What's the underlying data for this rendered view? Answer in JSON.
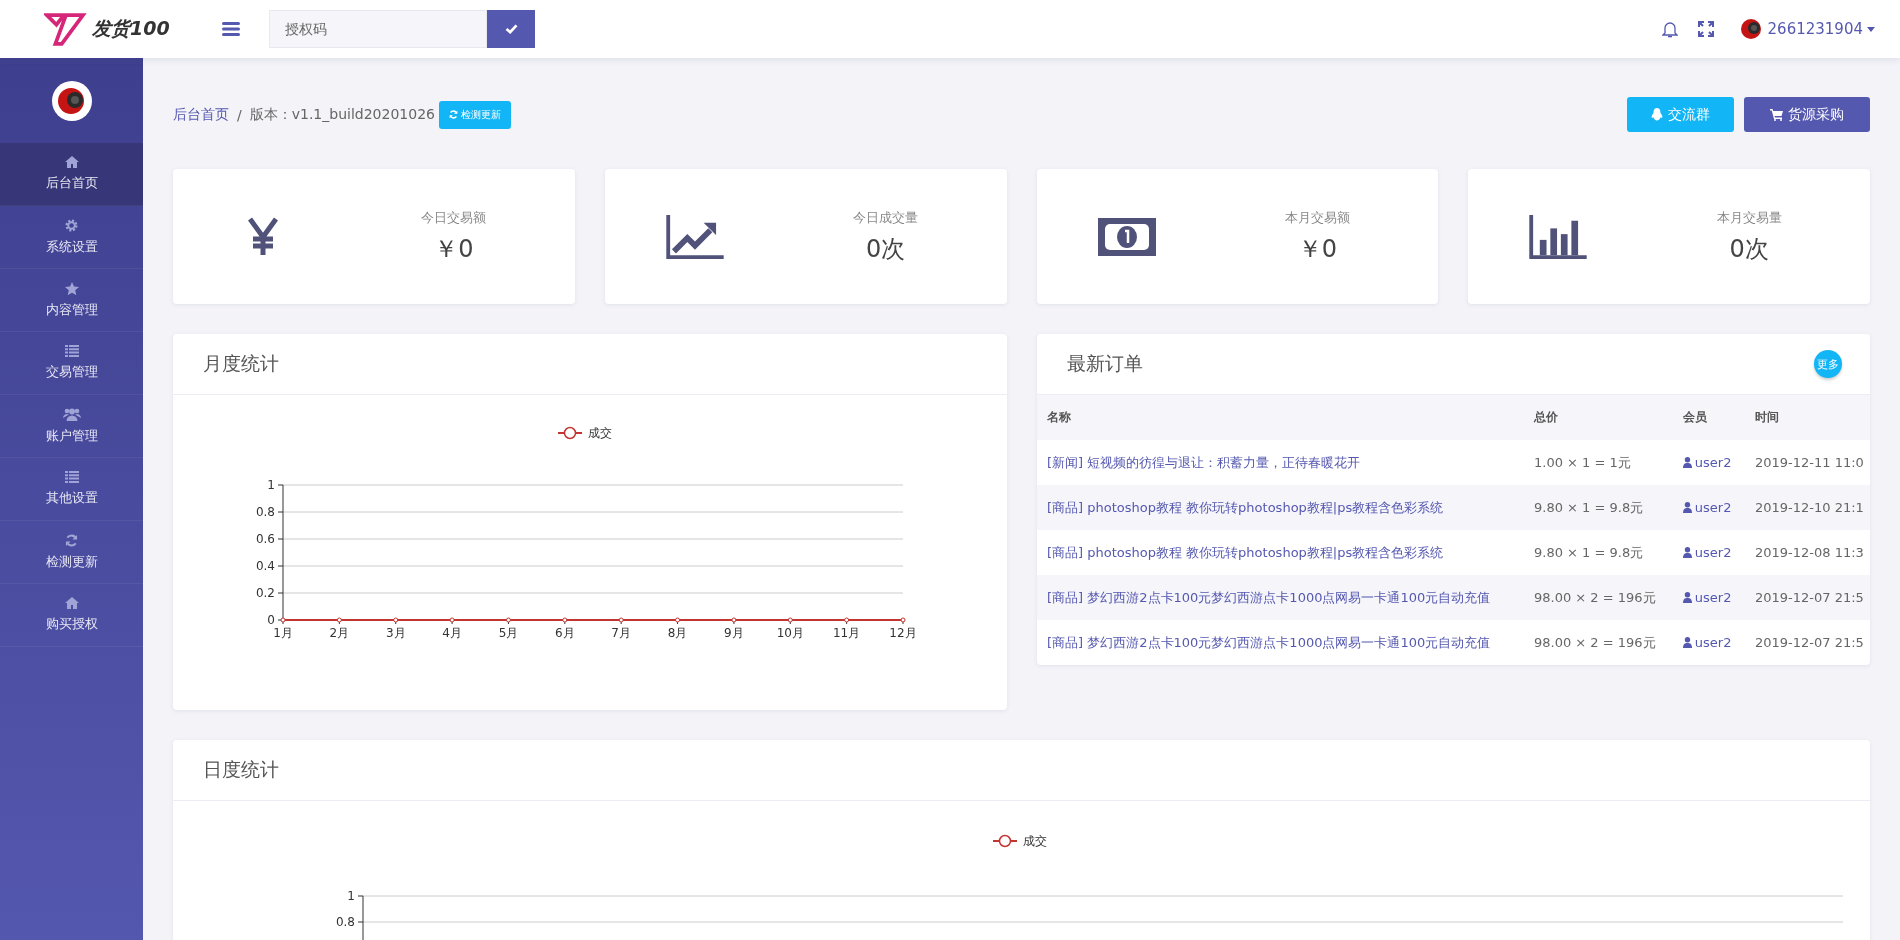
{
  "header": {
    "logo_text": "发货100",
    "search": {
      "placeholder": "授权码"
    },
    "username": "2661231904"
  },
  "sidebar": {
    "items": [
      {
        "label": "后台首页",
        "selected": true
      },
      {
        "label": "系统设置",
        "selected": false
      },
      {
        "label": "内容管理",
        "selected": false
      },
      {
        "label": "交易管理",
        "selected": false
      },
      {
        "label": "账户管理",
        "selected": false
      },
      {
        "label": "其他设置",
        "selected": false
      },
      {
        "label": "检测更新",
        "selected": false
      },
      {
        "label": "购买授权",
        "selected": false
      }
    ]
  },
  "breadcrumb": {
    "home": "后台首页",
    "separator": "/",
    "version": "版本：v1.1_build20201026",
    "update_button": "检测更新"
  },
  "actions": [
    "交流群",
    "货源采购"
  ],
  "stats": [
    {
      "label": "今日交易额",
      "value": "￥0"
    },
    {
      "label": "今日成交量",
      "value": "0次"
    },
    {
      "label": "本月交易额",
      "value": "￥0"
    },
    {
      "label": "本月交易量",
      "value": "0次"
    }
  ],
  "monthly": {
    "title": "月度统计",
    "chart_data": {
      "type": "line",
      "grid": true,
      "categories": [
        "1月",
        "2月",
        "3月",
        "4月",
        "5月",
        "6月",
        "7月",
        "8月",
        "9月",
        "10月",
        "11月",
        "12月"
      ],
      "ylim": [
        0,
        1
      ],
      "yticks": [
        0,
        0.2,
        0.4,
        0.6,
        0.8,
        1
      ],
      "series": [
        {
          "name": "成交",
          "color": "#c23531",
          "marker": "circle",
          "values": [
            0,
            0,
            0,
            0,
            0,
            0,
            0,
            0,
            0,
            0,
            0,
            0
          ]
        }
      ]
    }
  },
  "orders": {
    "title": "最新订单",
    "more": "更多",
    "columns": [
      "名称",
      "总价",
      "会员",
      "时间"
    ],
    "rows": [
      {
        "name": "[新闻] 短视频的彷徨与退让：积蓄力量，正待春暖花开",
        "price": "1.00 × 1 = 1元",
        "member": "user2",
        "time": "2019-12-11 11:0"
      },
      {
        "name": "[商品] photoshop教程 教你玩转photoshop教程|ps教程含色彩系统",
        "price": "9.80 × 1 = 9.8元",
        "member": "user2",
        "time": "2019-12-10 21:1"
      },
      {
        "name": "[商品] photoshop教程 教你玩转photoshop教程|ps教程含色彩系统",
        "price": "9.80 × 1 = 9.8元",
        "member": "user2",
        "time": "2019-12-08 11:3"
      },
      {
        "name": "[商品] 梦幻西游2点卡100元梦幻西游点卡1000点网易一卡通100元自动充值",
        "price": "98.00 × 2 = 196元",
        "member": "user2",
        "time": "2019-12-07 21:5"
      },
      {
        "name": "[商品] 梦幻西游2点卡100元梦幻西游点卡1000点网易一卡通100元自动充值",
        "price": "98.00 × 2 = 196元",
        "member": "user2",
        "time": "2019-12-07 21:5"
      }
    ]
  },
  "daily": {
    "title": "日度统计",
    "legend": "成交",
    "y_tick_labels": [
      "1",
      "0.8"
    ]
  }
}
